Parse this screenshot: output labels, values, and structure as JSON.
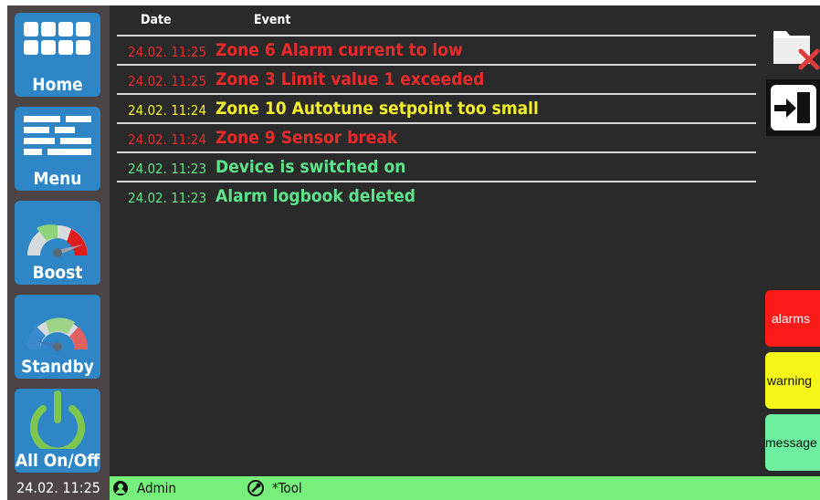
{
  "sidebar": {
    "home": {
      "label": "Home",
      "icon": "grid-icon"
    },
    "menu": {
      "label": "Menu",
      "icon": "menu-list-icon"
    },
    "boost": {
      "label": "Boost",
      "icon": "gauge-boost-icon"
    },
    "standby": {
      "label": "Standby",
      "icon": "gauge-standby-icon"
    },
    "all_on_off": {
      "label": "All On/Off",
      "icon": "power-icon"
    }
  },
  "log": {
    "headers": {
      "date": "Date",
      "event": "Event"
    },
    "entries": [
      {
        "date": "24.02. 11:25",
        "event": "Zone 6 Alarm current to low",
        "level": "alarm",
        "color": "#e82a2a"
      },
      {
        "date": "24.02. 11:25",
        "event": "Zone 3 Limit value 1 exceeded",
        "level": "alarm",
        "color": "#e82a2a"
      },
      {
        "date": "24.02. 11:24",
        "event": "Zone 10 Autotune setpoint too small",
        "level": "warning",
        "color": "#f2ee2a"
      },
      {
        "date": "24.02. 11:24",
        "event": "Zone 9 Sensor break",
        "level": "alarm",
        "color": "#e82a2a"
      },
      {
        "date": "24.02. 11:23",
        "event": "Device is switched on",
        "level": "message",
        "color": "#5fe38a"
      },
      {
        "date": "24.02. 11:23",
        "event": "Alarm logbook deleted",
        "level": "message",
        "color": "#5fe38a"
      }
    ]
  },
  "right_panel": {
    "delete_icon": "folder-delete-icon",
    "exit_icon": "logout-icon",
    "filters": [
      {
        "label": "alarms",
        "bg": "#ff1a1a",
        "fg": "#ffffff"
      },
      {
        "label": "warning",
        "bg": "#f5f51a",
        "fg": "#111111"
      },
      {
        "label": "message",
        "bg": "#6ff0a0",
        "fg": "#111111"
      }
    ]
  },
  "statusbar": {
    "datetime": "24.02. 11:25",
    "user": "Admin",
    "user_icon": "user-icon",
    "tool": "*Tool",
    "tool_icon": "tool-icon"
  }
}
